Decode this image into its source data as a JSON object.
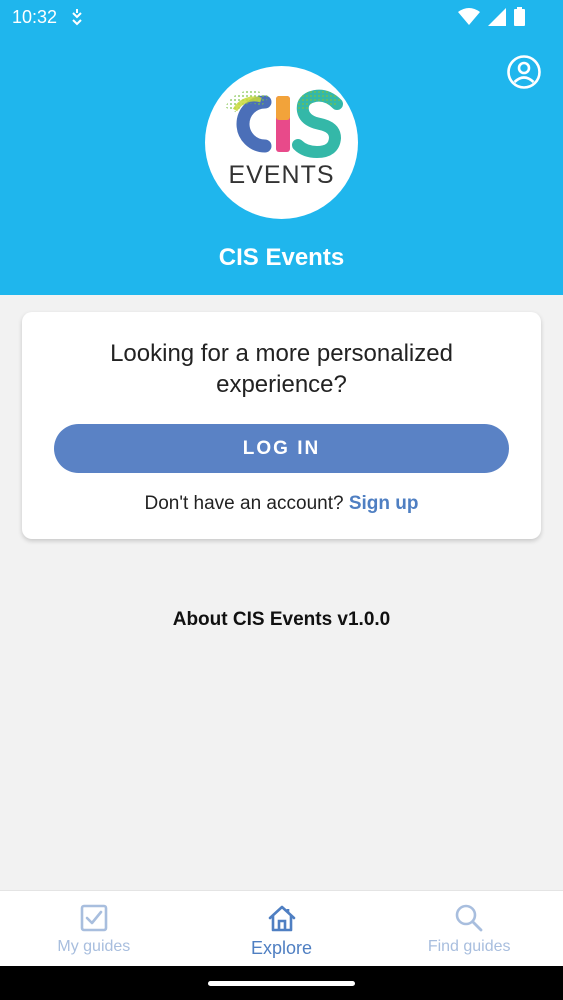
{
  "status_bar": {
    "time": "10:32",
    "icons": [
      "notification-icon",
      "wifi-icon",
      "signal-icon",
      "battery-icon"
    ]
  },
  "header": {
    "background_color": "#1fb6ed",
    "logo": {
      "top_text": "CIS",
      "bottom_text": "EVENTS"
    },
    "title": "CIS Events",
    "profile_icon": "account-circle-icon"
  },
  "login_card": {
    "heading_line1": "Looking for a more personalized",
    "heading_line2": "experience?",
    "login_button_label": "LOG IN",
    "signup_prompt": "Don't have an account?",
    "signup_link": "Sign up",
    "accent_color": "#5a82c5"
  },
  "about_link": "About CIS Events v1.0.0",
  "bottom_nav": {
    "items": [
      {
        "label": "My guides",
        "icon": "checkbox-icon",
        "active": false
      },
      {
        "label": "Explore",
        "icon": "home-icon",
        "active": true
      },
      {
        "label": "Find guides",
        "icon": "search-icon",
        "active": false
      }
    ]
  }
}
